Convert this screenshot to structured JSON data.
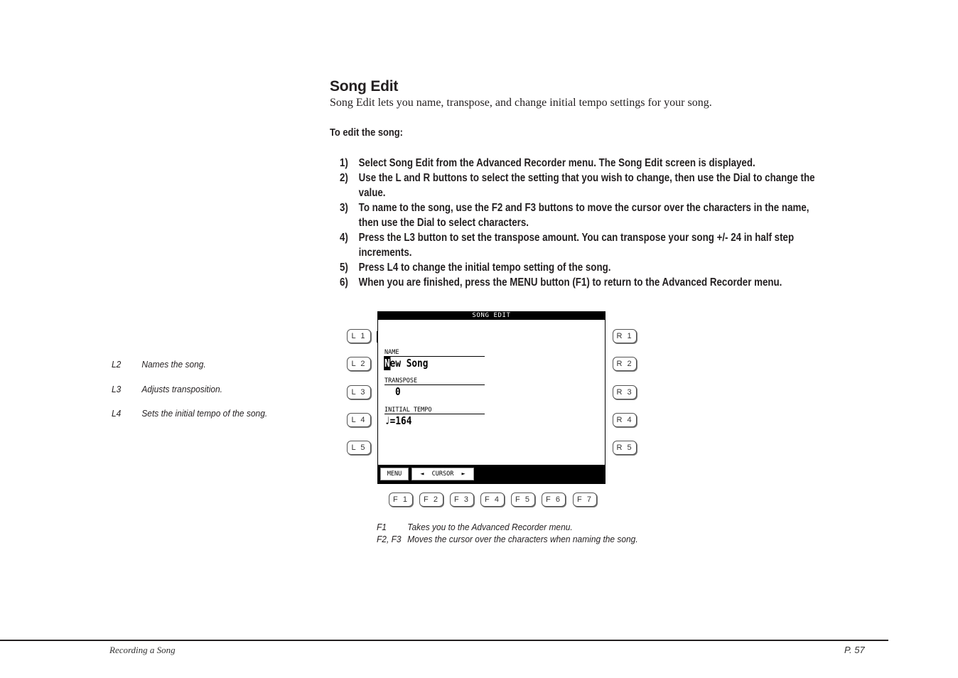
{
  "page": {
    "title": "Song Edit",
    "intro": "Song Edit lets you name, transpose, and change initial tempo settings for your song.",
    "subheading": "To edit the song:",
    "steps": [
      {
        "num": "1)",
        "lines": [
          "Select Song Edit from the Advanced Recorder menu.  The Song Edit screen is displayed."
        ]
      },
      {
        "num": "2)",
        "lines": [
          "Use the L and R buttons to select the setting that you wish to change, then use the Dial to change the",
          "value."
        ]
      },
      {
        "num": "3)",
        "lines": [
          "To name to the song, use the F2 and F3 buttons to move the cursor over the characters in the name,",
          "then use the Dial to select characters."
        ]
      },
      {
        "num": "4)",
        "lines": [
          "Press the L3 button to set the transpose amount.  You can transpose your song +/- 24 in half step",
          "increments."
        ]
      },
      {
        "num": "5)",
        "lines": [
          "Press L4 to change the initial tempo setting of the song."
        ]
      },
      {
        "num": "6)",
        "lines": [
          "When you are finished, press the MENU button (F1) to return to the Advanced Recorder menu."
        ]
      }
    ]
  },
  "side_notes": [
    {
      "key": "L2",
      "text": "Names the song."
    },
    {
      "key": "L3",
      "text": "Adjusts transposition."
    },
    {
      "key": "L4",
      "text": "Sets the initial tempo of the song."
    }
  ],
  "panel": {
    "left_buttons": [
      "L 1",
      "L 2",
      "L 3",
      "L 4",
      "L 5"
    ],
    "right_buttons": [
      "R 1",
      "R 2",
      "R 3",
      "R 4",
      "R 5"
    ],
    "function_buttons": [
      "F 1",
      "F 2",
      "F 3",
      "F 4",
      "F 5",
      "F 6",
      "F 7"
    ],
    "lcd": {
      "header": "SONG EDIT",
      "name_label": "NAME",
      "name_cursor_char": "N",
      "name_rest": "ew Song",
      "transpose_label": "TRANSPOSE",
      "transpose_value": "0",
      "tempo_label": "INITIAL TEMPO",
      "tempo_note": "♩",
      "tempo_value": "=164",
      "soft_menu": "MENU",
      "soft_cursor_left": "◄",
      "soft_cursor_label": "CURSOR",
      "soft_cursor_right": "►"
    }
  },
  "function_notes": [
    {
      "key": "F1",
      "text": "Takes you to the Advanced Recorder menu."
    },
    {
      "key": "F2, F3",
      "text": "Moves the cursor over the characters when naming the song."
    }
  ],
  "footer": {
    "section": "Recording a Song",
    "page_number": "P. 57"
  }
}
